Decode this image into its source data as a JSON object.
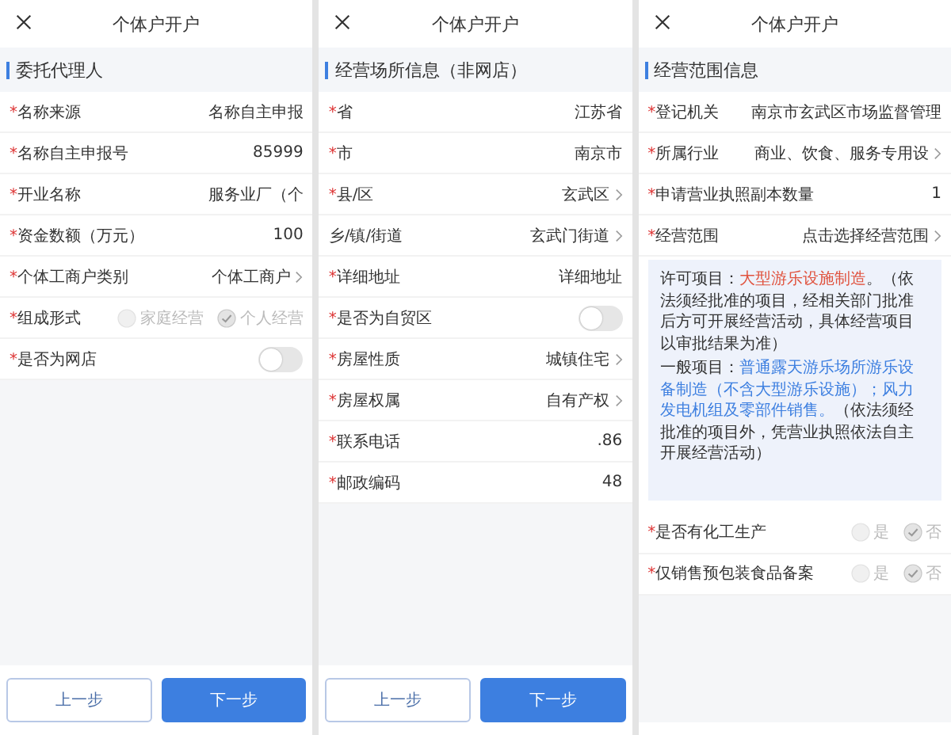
{
  "panels": [
    {
      "title": "个体户开户",
      "section": "委托代理人",
      "fields": [
        {
          "kind": "text",
          "asterisk": "*",
          "label": "名称来源",
          "value": "名称自主申报",
          "chevron": false
        },
        {
          "kind": "text",
          "asterisk": "*",
          "label": "名称自主申报号",
          "value": "85999",
          "chevron": false
        },
        {
          "kind": "text",
          "asterisk": "*",
          "label": "开业名称",
          "value": "服务业厂（个",
          "chevron": false
        },
        {
          "kind": "text",
          "asterisk": "*",
          "label": "资金数额（万元）",
          "value": "100",
          "chevron": false
        },
        {
          "kind": "text",
          "asterisk": "*",
          "label": "个体工商户类别",
          "value": "个体工商户",
          "chevron": true
        },
        {
          "kind": "radio",
          "asterisk": "*",
          "label": "组成形式",
          "options": [
            {
              "label": "家庭经营",
              "selected": false
            },
            {
              "label": "个人经营",
              "selected": true
            }
          ]
        },
        {
          "kind": "toggle",
          "asterisk": "*",
          "label": "是否为网店",
          "on": false
        }
      ],
      "buttons": [
        {
          "kind": "secondary",
          "label": "上一步"
        },
        {
          "kind": "primary",
          "label": "下一步"
        }
      ]
    },
    {
      "title": "个体户开户",
      "section": "经营场所信息（非网店）",
      "fields": [
        {
          "kind": "text",
          "asterisk": "*",
          "label": "省",
          "value": "江苏省",
          "chevron": false
        },
        {
          "kind": "text",
          "asterisk": "*",
          "label": "市",
          "value": "南京市",
          "chevron": false
        },
        {
          "kind": "text",
          "asterisk": "*",
          "label": "县/区",
          "value": "玄武区",
          "chevron": true
        },
        {
          "kind": "text",
          "label": "乡/镇/街道",
          "value": "玄武门街道",
          "chevron": true
        },
        {
          "kind": "text",
          "asterisk": "*",
          "label": "详细地址",
          "value": "详细地址",
          "chevron": false
        },
        {
          "kind": "toggle",
          "asterisk": "*",
          "label": "是否为自贸区",
          "on": false
        },
        {
          "kind": "text",
          "asterisk": "*",
          "label": "房屋性质",
          "value": "城镇住宅",
          "chevron": true
        },
        {
          "kind": "text",
          "asterisk": "*",
          "label": "房屋权属",
          "value": "自有产权",
          "chevron": true
        },
        {
          "kind": "text",
          "asterisk": "*",
          "label": "联系电话",
          "value": ".86",
          "chevron": false
        },
        {
          "kind": "text",
          "asterisk": "*",
          "label": "邮政编码",
          "value": "48",
          "chevron": false
        }
      ],
      "buttons": [
        {
          "kind": "secondary",
          "label": "上一步"
        },
        {
          "kind": "primary",
          "label": "下一步"
        }
      ]
    },
    {
      "title": "个体户开户",
      "section": "经营范围信息",
      "fields": [
        {
          "kind": "text",
          "asterisk": "*",
          "label": "登记机关",
          "value": "南京市玄武区市场监督管理",
          "chevron": false
        },
        {
          "kind": "text",
          "asterisk": "*",
          "label": "所属行业",
          "value": "商业、饮食、服务专用设",
          "chevron": true
        },
        {
          "kind": "text",
          "asterisk": "*",
          "label": "申请营业执照副本数量",
          "value": "1",
          "chevron": false
        },
        {
          "kind": "text",
          "asterisk": "*",
          "label": "经营范围",
          "value": "点击选择经营范围",
          "chevron": true
        },
        {
          "kind": "note",
          "paragraphs": [
            [
              {
                "text": "许可项目：",
                "color": "#333333"
              },
              {
                "text": "大型游乐设施制造",
                "color": "#e0533f"
              },
              {
                "text": "。（依法须经批准的项目，经相关部门批准后方可开展经营活动，具体经营项目以审批结果为准）",
                "color": "#333333"
              }
            ],
            [
              {
                "text": "一般项目：",
                "color": "#333333"
              },
              {
                "text": "普通露天游乐场所游乐设备制造（不含大型游乐设施）；风力发电机组及零部件销售。",
                "color": "#3d7fe0"
              },
              {
                "text": "（依法须经批准的项目外，凭营业执照依法自主开展经营活动）",
                "color": "#333333"
              }
            ]
          ]
        },
        {
          "kind": "radio",
          "asterisk": "*",
          "label": "是否有化工生产",
          "options": [
            {
              "label": "是",
              "selected": false
            },
            {
              "label": "否",
              "selected": true
            }
          ]
        },
        {
          "kind": "radio",
          "asterisk": "*",
          "label": "仅销售预包装食品备案",
          "options": [
            {
              "label": "是",
              "selected": false
            },
            {
              "label": "否",
              "selected": true
            }
          ]
        }
      ]
    }
  ]
}
